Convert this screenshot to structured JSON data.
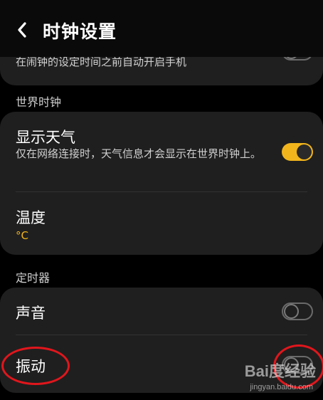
{
  "header": {
    "title": "时钟设置",
    "back_icon": "chevron-left-icon"
  },
  "alarm": {
    "auto_power_on_desc": "在闹钟的设定时间之前自动开启手机"
  },
  "world_clock": {
    "section_label": "世界时钟",
    "show_weather": {
      "title": "显示天气",
      "desc": "仅在网络连接时，天气信息才会显示在世界时钟上。",
      "enabled": true
    },
    "temperature": {
      "title": "温度",
      "value": "°C"
    }
  },
  "timer": {
    "section_label": "定时器",
    "sound": {
      "title": "声音",
      "enabled": false
    },
    "vibration": {
      "title": "振动",
      "enabled": false
    }
  },
  "watermark": {
    "brand": "Bai度经验",
    "url": "jingyan.baidu.com"
  },
  "colors": {
    "accent": "#f2b51c",
    "card": "#1f1f1f",
    "background": "#000000",
    "annotation": "#e0161c"
  }
}
